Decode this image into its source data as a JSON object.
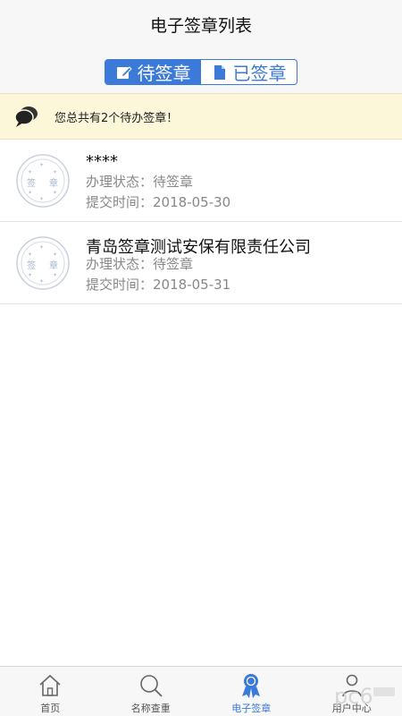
{
  "header": {
    "title": "电子签章列表"
  },
  "segments": {
    "pending_label": "待签章",
    "done_label": "已签章"
  },
  "notice": {
    "text": "您总共有2个待办签章！"
  },
  "seal": {
    "label_left": "签",
    "label_right": "章"
  },
  "items": [
    {
      "name": "****",
      "status_label": "办理状态：",
      "status": "待签章",
      "date_label": "提交时间：",
      "date": "2018-05-30"
    },
    {
      "name": "青岛签章测试安保有限责任公司",
      "status_label": "办理状态：",
      "status": "待签章",
      "date_label": "提交时间：",
      "date": "2018-05-31"
    }
  ],
  "tabbar": {
    "tabs": [
      {
        "label": "首页",
        "icon": "home-icon"
      },
      {
        "label": "名称查重",
        "icon": "search-icon"
      },
      {
        "label": "电子签章",
        "icon": "ribbon-badge-icon"
      },
      {
        "label": "用户中心",
        "icon": "user-icon"
      }
    ]
  },
  "colors": {
    "accent": "#3b7ad9",
    "notice_bg": "#fbf7d8",
    "bar_bg": "#f7f7f7"
  }
}
